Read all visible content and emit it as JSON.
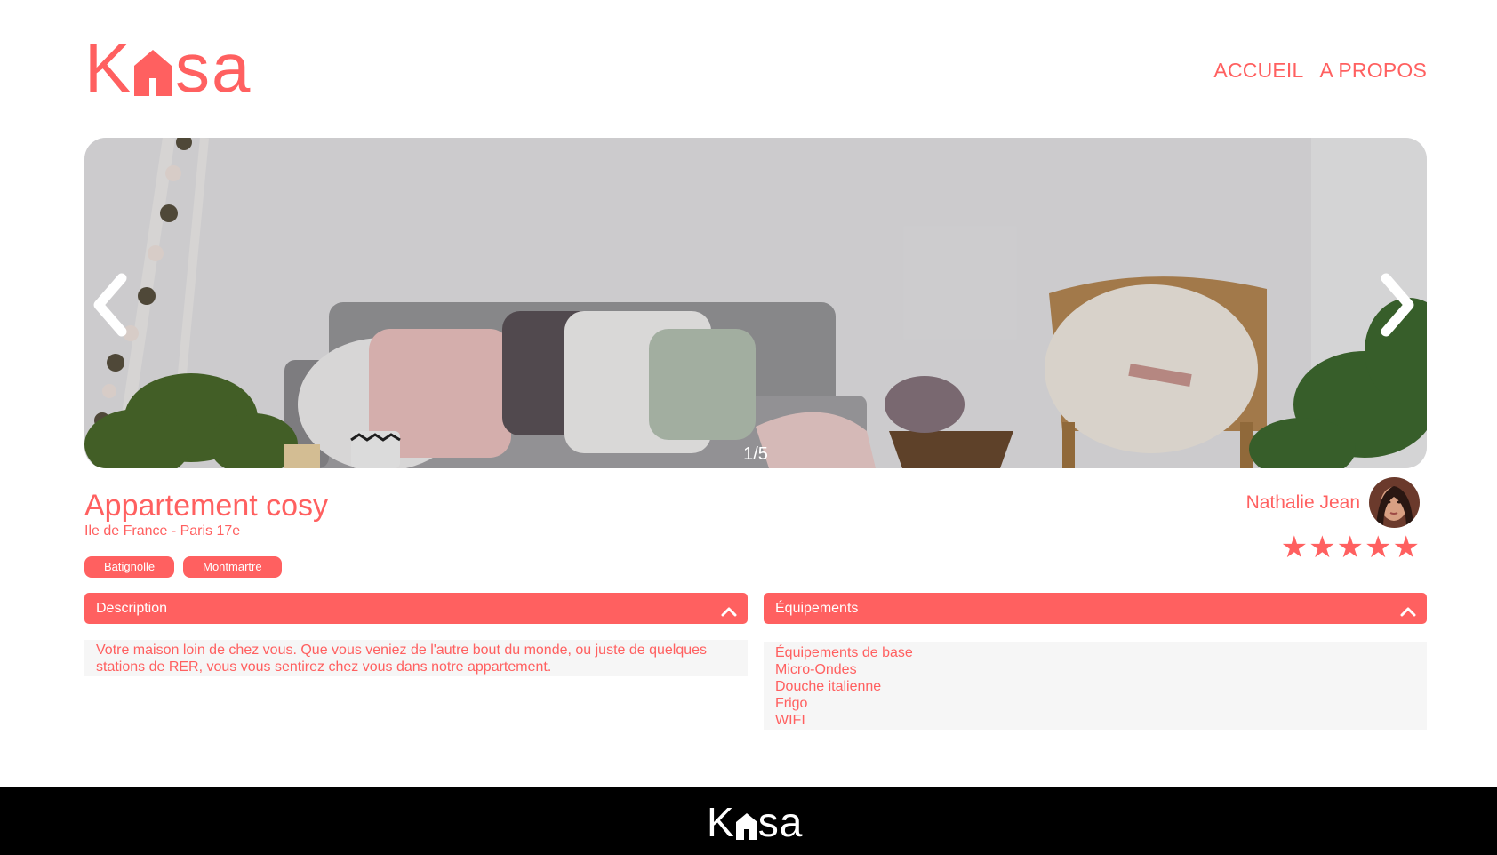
{
  "logo": {
    "text_start": "K",
    "text_end": "sa",
    "icon": "house-icon"
  },
  "nav": {
    "home": "ACCUEIL",
    "about": "A PROPOS"
  },
  "carousel": {
    "counter": "1/5",
    "prev_icon": "chevron-left-icon",
    "next_icon": "chevron-right-icon"
  },
  "listing": {
    "title": "Appartement cosy",
    "location": "Ile de France - Paris 17e",
    "tags": [
      "Batignolle",
      "Montmartre"
    ]
  },
  "host": {
    "name": "Nathalie Jean"
  },
  "rating": {
    "value": 5,
    "max": 5
  },
  "description": {
    "title": "Description",
    "text": "Votre maison loin de chez vous. Que vous veniez de l'autre bout du monde, ou juste de quelques stations de RER, vous vous sentirez chez vous dans notre appartement."
  },
  "equipments": {
    "title": "Équipements",
    "items": [
      "Équipements de base",
      "Micro-Ondes",
      "Douche italienne",
      "Frigo",
      "WIFI"
    ]
  },
  "footer": {
    "logo_start": "K",
    "logo_end": "sa"
  },
  "colors": {
    "accent": "#FF6060",
    "panel": "#F6F6F6",
    "footer": "#000000"
  }
}
